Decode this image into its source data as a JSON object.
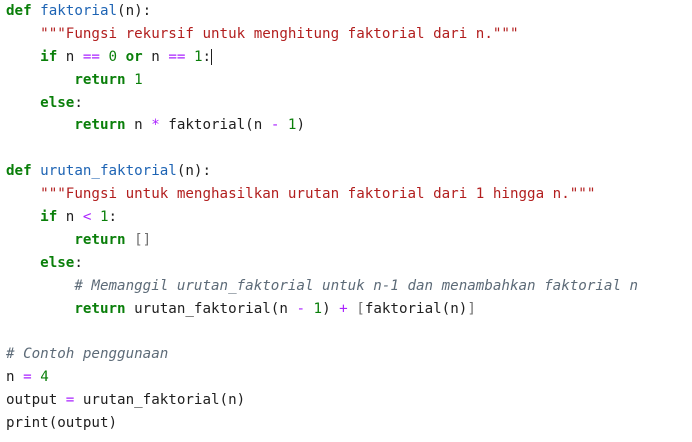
{
  "editor": {
    "lines": [
      [
        {
          "t": "kw",
          "v": "def"
        },
        {
          "t": "plain",
          "v": " "
        },
        {
          "t": "fn",
          "v": "faktorial"
        },
        {
          "t": "plain",
          "v": "(n):"
        }
      ],
      [
        {
          "t": "plain",
          "v": "    "
        },
        {
          "t": "str",
          "v": "\"\"\"Fungsi rekursif untuk menghitung faktorial dari n.\"\"\""
        }
      ],
      [
        {
          "t": "plain",
          "v": "    "
        },
        {
          "t": "kw",
          "v": "if"
        },
        {
          "t": "plain",
          "v": " n "
        },
        {
          "t": "op",
          "v": "=="
        },
        {
          "t": "plain",
          "v": " "
        },
        {
          "t": "num",
          "v": "0"
        },
        {
          "t": "plain",
          "v": " "
        },
        {
          "t": "kw",
          "v": "or"
        },
        {
          "t": "plain",
          "v": " n "
        },
        {
          "t": "op",
          "v": "=="
        },
        {
          "t": "plain",
          "v": " "
        },
        {
          "t": "num",
          "v": "1"
        },
        {
          "t": "plain",
          "v": ":"
        },
        {
          "t": "caret",
          "v": ""
        }
      ],
      [
        {
          "t": "plain",
          "v": "        "
        },
        {
          "t": "kw",
          "v": "return"
        },
        {
          "t": "plain",
          "v": " "
        },
        {
          "t": "num",
          "v": "1"
        }
      ],
      [
        {
          "t": "plain",
          "v": "    "
        },
        {
          "t": "kw",
          "v": "else"
        },
        {
          "t": "plain",
          "v": ":"
        }
      ],
      [
        {
          "t": "plain",
          "v": "        "
        },
        {
          "t": "kw",
          "v": "return"
        },
        {
          "t": "plain",
          "v": " n "
        },
        {
          "t": "op",
          "v": "*"
        },
        {
          "t": "plain",
          "v": " faktorial(n "
        },
        {
          "t": "op",
          "v": "-"
        },
        {
          "t": "plain",
          "v": " "
        },
        {
          "t": "num",
          "v": "1"
        },
        {
          "t": "plain",
          "v": ")"
        }
      ],
      [],
      [
        {
          "t": "kw",
          "v": "def"
        },
        {
          "t": "plain",
          "v": " "
        },
        {
          "t": "fn",
          "v": "urutan_faktorial"
        },
        {
          "t": "plain",
          "v": "(n):"
        }
      ],
      [
        {
          "t": "plain",
          "v": "    "
        },
        {
          "t": "str",
          "v": "\"\"\"Fungsi untuk menghasilkan urutan faktorial dari 1 hingga n.\"\"\""
        }
      ],
      [
        {
          "t": "plain",
          "v": "    "
        },
        {
          "t": "kw",
          "v": "if"
        },
        {
          "t": "plain",
          "v": " n "
        },
        {
          "t": "op",
          "v": "<"
        },
        {
          "t": "plain",
          "v": " "
        },
        {
          "t": "num",
          "v": "1"
        },
        {
          "t": "plain",
          "v": ":"
        }
      ],
      [
        {
          "t": "plain",
          "v": "        "
        },
        {
          "t": "kw",
          "v": "return"
        },
        {
          "t": "plain",
          "v": " "
        },
        {
          "t": "br",
          "v": "[]"
        }
      ],
      [
        {
          "t": "plain",
          "v": "    "
        },
        {
          "t": "kw",
          "v": "else"
        },
        {
          "t": "plain",
          "v": ":"
        }
      ],
      [
        {
          "t": "plain",
          "v": "        "
        },
        {
          "t": "cm",
          "v": "# Memanggil urutan_faktorial untuk n-1 dan menambahkan faktorial n"
        }
      ],
      [
        {
          "t": "plain",
          "v": "        "
        },
        {
          "t": "kw",
          "v": "return"
        },
        {
          "t": "plain",
          "v": " urutan_faktorial(n "
        },
        {
          "t": "op",
          "v": "-"
        },
        {
          "t": "plain",
          "v": " "
        },
        {
          "t": "num",
          "v": "1"
        },
        {
          "t": "plain",
          "v": ") "
        },
        {
          "t": "op",
          "v": "+"
        },
        {
          "t": "plain",
          "v": " "
        },
        {
          "t": "br",
          "v": "["
        },
        {
          "t": "plain",
          "v": "faktorial(n)"
        },
        {
          "t": "br",
          "v": "]"
        }
      ],
      [],
      [
        {
          "t": "cm",
          "v": "# Contoh penggunaan"
        }
      ],
      [
        {
          "t": "plain",
          "v": "n "
        },
        {
          "t": "op",
          "v": "="
        },
        {
          "t": "plain",
          "v": " "
        },
        {
          "t": "num",
          "v": "4"
        }
      ],
      [
        {
          "t": "plain",
          "v": "output "
        },
        {
          "t": "op",
          "v": "="
        },
        {
          "t": "plain",
          "v": " urutan_faktorial(n)"
        }
      ],
      [
        {
          "t": "plain",
          "v": "print(output)"
        }
      ]
    ]
  }
}
